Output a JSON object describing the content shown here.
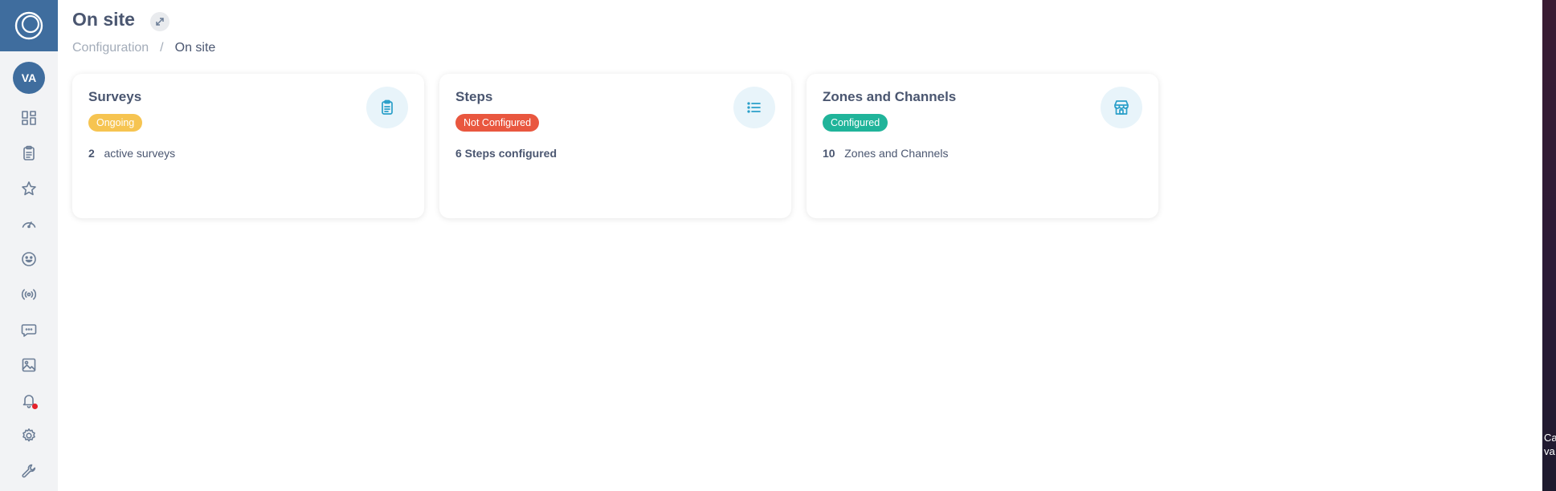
{
  "header": {
    "title": "On site",
    "expand_icon": "expand-icon"
  },
  "breadcrumb": {
    "items": [
      "Configuration",
      "On site"
    ],
    "separator": "/"
  },
  "sidebar": {
    "avatar_initials": "VA",
    "items": [
      {
        "icon": "dashboard-icon"
      },
      {
        "icon": "clipboard-icon"
      },
      {
        "icon": "star-icon"
      },
      {
        "icon": "gauge-icon"
      },
      {
        "icon": "smiley-icon"
      },
      {
        "icon": "broadcast-icon"
      },
      {
        "icon": "chat-icon"
      },
      {
        "icon": "image-icon"
      },
      {
        "icon": "bell-icon",
        "has_notification": true
      },
      {
        "icon": "gear-icon"
      },
      {
        "icon": "wrench-icon"
      }
    ]
  },
  "cards": [
    {
      "title": "Surveys",
      "badge": "Ongoing",
      "badge_color": "#f6c451",
      "stat_number": "2",
      "stat_text": "active surveys",
      "icon": "clipboard-icon"
    },
    {
      "title": "Steps",
      "badge": "Not Configured",
      "badge_color": "#e9573f",
      "stat_number": "6 Steps configured",
      "stat_text": "",
      "icon": "list-icon"
    },
    {
      "title": "Zones and Channels",
      "badge": "Configured",
      "badge_color": "#20b49a",
      "stat_number": "10",
      "stat_text": "Zones and Channels",
      "icon": "store-icon"
    }
  ],
  "edge_text": "Ca\nva",
  "colors": {
    "brand": "#3f6d9e",
    "accent_icon": "#2a9fc9"
  }
}
